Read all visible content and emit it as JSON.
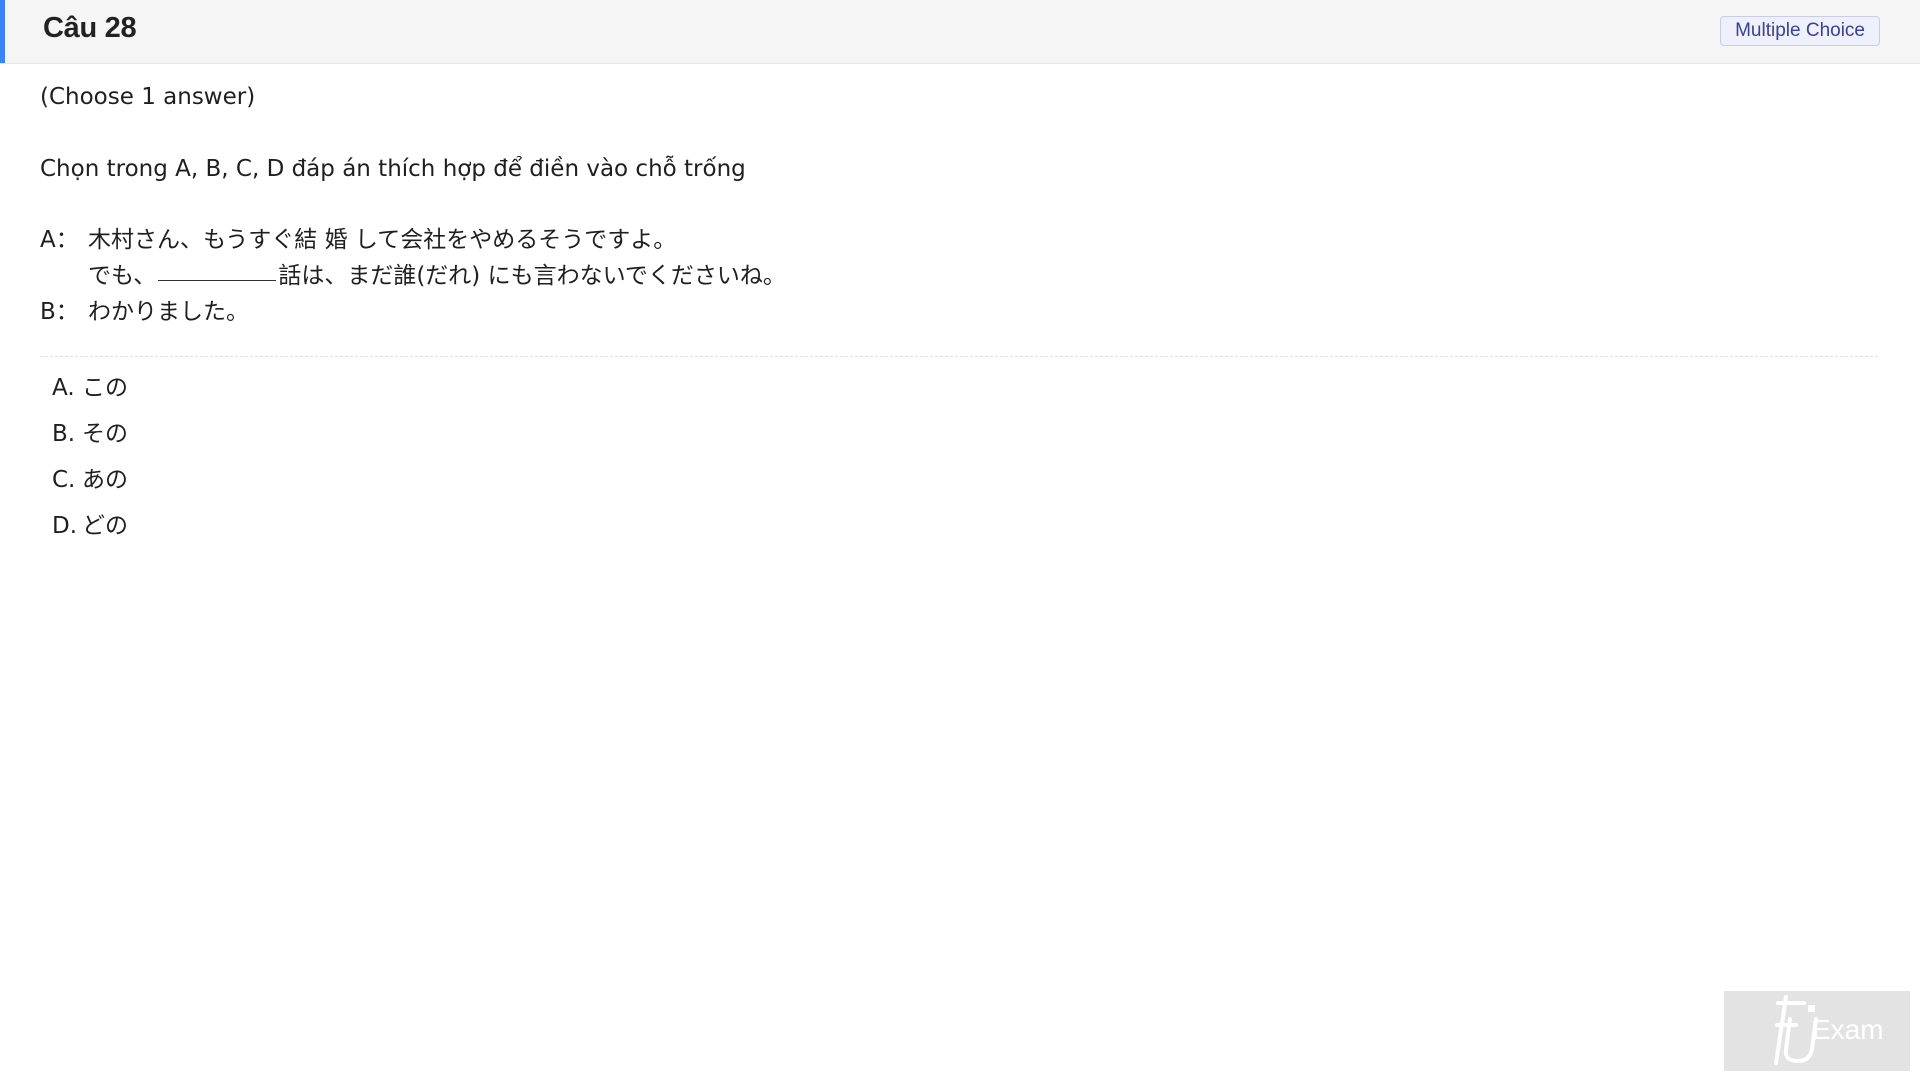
{
  "header": {
    "title": "Câu 28",
    "type_badge": "Multiple Choice",
    "accent_color": "#3b82f6"
  },
  "question": {
    "instruction": "(Choose 1 answer)",
    "prompt": "Chọn trong A, B, C, D đáp án thích hợp để điền vào chỗ trống",
    "dialog": [
      {
        "speaker": "A：",
        "text_before": "木村さん、もうすぐ結 婚 して会社をやめるそうですよ。",
        "text_after": ""
      },
      {
        "speaker": "",
        "text_before": "でも、",
        "text_after": "話は、まだ誰(だれ) にも言わないでくださいね。"
      },
      {
        "speaker": "B：",
        "text_before": "わかりました。",
        "text_after": ""
      }
    ]
  },
  "options": [
    {
      "letter": "A.",
      "text": "この"
    },
    {
      "letter": "B.",
      "text": "その"
    },
    {
      "letter": "C.",
      "text": "あの"
    },
    {
      "letter": "D.",
      "text": "どの"
    }
  ],
  "watermark": {
    "logo_text": "FU",
    "logo_suffix": "Exam"
  }
}
